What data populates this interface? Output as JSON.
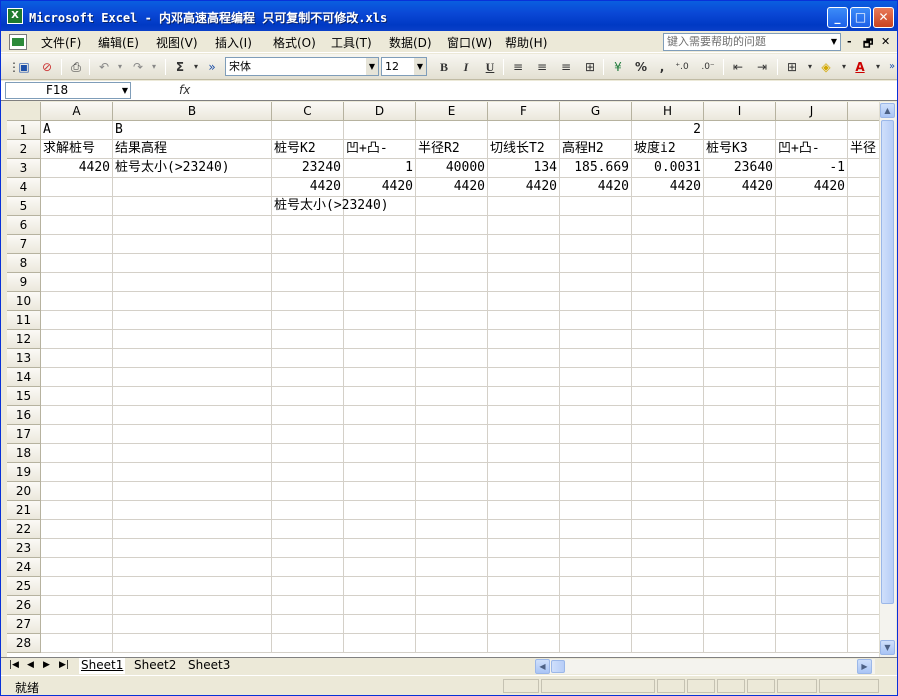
{
  "window": {
    "title": "Microsoft Excel - 内邓高速高程编程 只可复制不可修改.xls",
    "min": "_",
    "max": "□",
    "close": "✕"
  },
  "menu": {
    "items": [
      "文件(F)",
      "编辑(E)",
      "视图(V)",
      "插入(I)",
      "格式(O)",
      "工具(T)",
      "数据(D)",
      "窗口(W)",
      "帮助(H)"
    ],
    "help_placeholder": "键入需要帮助的问题",
    "mdi": [
      "-",
      "🗗",
      "✕"
    ]
  },
  "toolbar": {
    "font_name": "宋体",
    "font_size": "12",
    "bold": "B",
    "italic": "I",
    "underline": "U",
    "sum": "Σ",
    "percent": "%",
    "comma": ",",
    "inc_dec": "+.0\n.00",
    "dec_dec": ".00\n+.0"
  },
  "formula_bar": {
    "name_box": "F18",
    "fx": "fx",
    "value": ""
  },
  "columns": [
    "A",
    "B",
    "C",
    "D",
    "E",
    "F",
    "G",
    "H",
    "I",
    "J"
  ],
  "rows": [
    "1",
    "2",
    "3",
    "4",
    "5",
    "6",
    "7",
    "8",
    "9",
    "10",
    "11",
    "12",
    "13",
    "14",
    "15",
    "16",
    "17",
    "18",
    "19",
    "20",
    "21",
    "22",
    "23",
    "24",
    "25",
    "26",
    "27",
    "28"
  ],
  "cells": {
    "A1": "A",
    "B1": "B",
    "H1": "2",
    "A2": "求解桩号",
    "B2": "结果高程",
    "C2": "桩号K2",
    "D2": "凹+凸-",
    "E2": "半径R2",
    "F2": "切线长T2",
    "G2": "高程H2",
    "H2": "坡度i2",
    "I2": "桩号K3",
    "J2": "凹+凸-",
    "K2": "半径",
    "A3": "4420",
    "B3": "桩号太小(>23240)",
    "C3": "23240",
    "D3": "1",
    "E3": "40000",
    "F3": "134",
    "G3": "185.669",
    "H3": "0.0031",
    "I3": "23640",
    "J3": "-1",
    "C4": "4420",
    "D4": "4420",
    "E4": "4420",
    "F4": "4420",
    "G4": "4420",
    "H4": "4420",
    "I4": "4420",
    "J4": "4420",
    "C5": "桩号太小(>23240)"
  },
  "sheets": [
    "Sheet1",
    "Sheet2",
    "Sheet3"
  ],
  "active_sheet": "Sheet1",
  "status": "就绪"
}
